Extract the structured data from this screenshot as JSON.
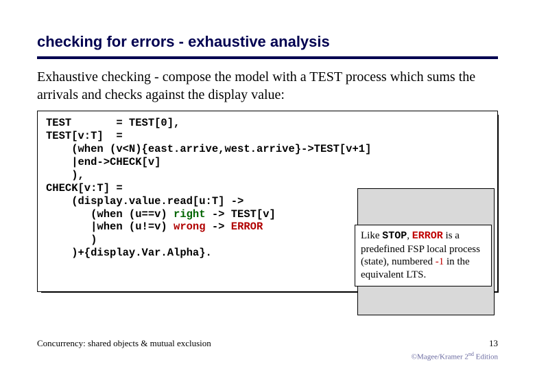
{
  "title": "checking for errors - exhaustive analysis",
  "intro": "Exhaustive checking - compose the model with a TEST process which sums the arrivals and checks against the display value:",
  "code": {
    "l1": "TEST       = TEST[0],",
    "l2": "TEST[v:T]  =",
    "l3": "    (when (v<N){east.arrive,west.arrive}->TEST[v+1]",
    "l4": "    |end->CHECK[v]",
    "l5": "    ),",
    "l6": "CHECK[v:T] =",
    "l7a": "    (display.value.read[u:T] ->",
    "l8a": "       (when (u==v) ",
    "l8b": "right",
    "l8c": " -> TEST[v]",
    "l9a": "       |when (u!=v) ",
    "l9b": "wrong",
    "l9c": " -> ",
    "l9d": "ERROR",
    "l10": "       )",
    "l11": "    )+{display.Var.Alpha}."
  },
  "callout": {
    "p1a": "Like ",
    "p1b": "STOP",
    "p1c": ", ",
    "p1d": "ERROR",
    "p1e": " is a predefined FSP local process (state), numbered ",
    "p1f": "-1",
    "p1g": " in the equivalent LTS."
  },
  "footer_left": "Concurrency: shared objects & mutual exclusion",
  "footer_right": "13",
  "copyright_a": "©Magee/Kramer 2",
  "copyright_b": "nd",
  "copyright_c": " Edition"
}
